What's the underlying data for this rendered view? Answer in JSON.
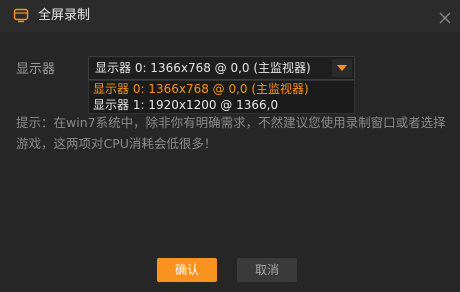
{
  "window": {
    "title": "全屏录制",
    "icon": "monitor-icon",
    "close_icon": "close-icon"
  },
  "display": {
    "label": "显示器",
    "selected": "显示器 0: 1366x768 @ 0,0 (主监视器)",
    "options": [
      "显示器 0: 1366x768 @ 0,0 (主监视器)",
      "显示器 1: 1920x1200 @ 1366,0"
    ]
  },
  "tip": "提示：在win7系统中，除非你有明确需求，不然建议您使用录制窗口或者选择游戏，这两项对CPU消耗会低很多！",
  "buttons": {
    "ok": "确认",
    "cancel": "取消"
  },
  "colors": {
    "accent": "#f7931e",
    "background": "#262626",
    "titlebar": "#2b2b2b"
  }
}
